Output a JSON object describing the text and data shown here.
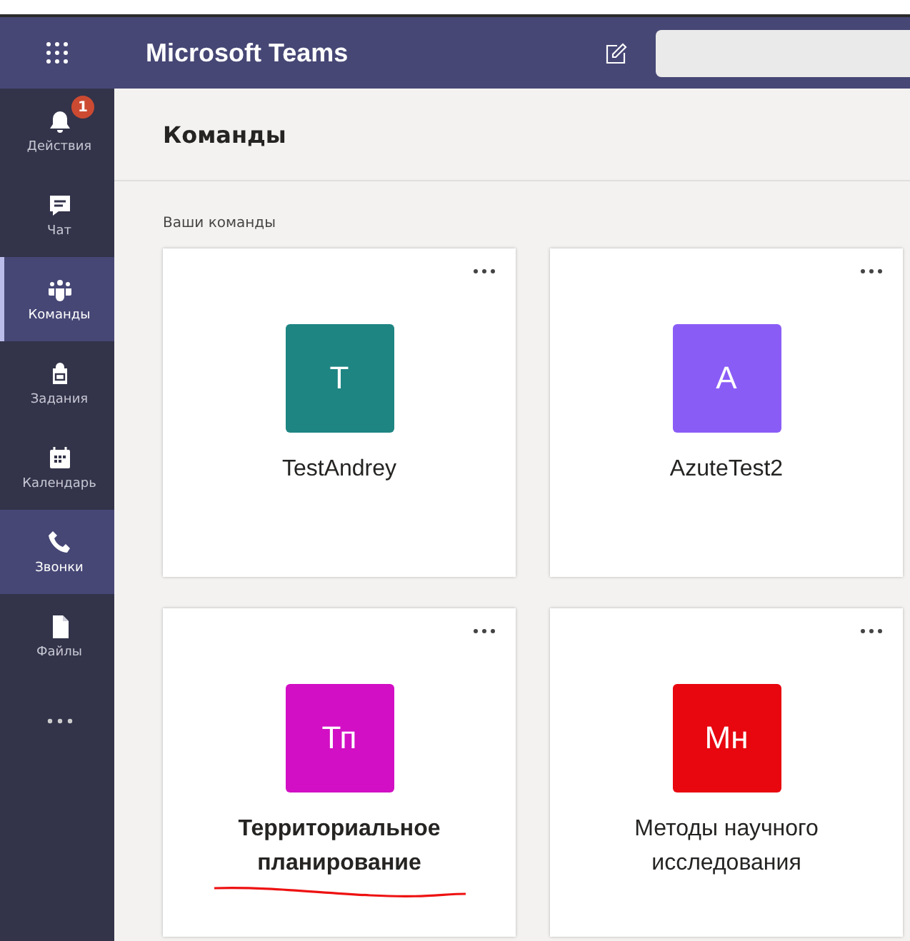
{
  "app": {
    "title": "Microsoft Teams"
  },
  "sidebar": {
    "items": [
      {
        "kind": "bell",
        "label": "Действия",
        "selected": false,
        "highlighted": false,
        "badge": "1"
      },
      {
        "kind": "chat",
        "label": "Чат",
        "selected": false,
        "highlighted": false
      },
      {
        "kind": "teams",
        "label": "Команды",
        "selected": true,
        "highlighted": false
      },
      {
        "kind": "bag",
        "label": "Задания",
        "selected": false,
        "highlighted": false
      },
      {
        "kind": "calendar",
        "label": "Календарь",
        "selected": false,
        "highlighted": false
      },
      {
        "kind": "phone",
        "label": "Звонки",
        "selected": false,
        "highlighted": true
      },
      {
        "kind": "file",
        "label": "Файлы",
        "selected": false,
        "highlighted": false
      },
      {
        "kind": "more",
        "selected": false,
        "highlighted": false
      }
    ]
  },
  "page": {
    "title": "Команды",
    "section": "Ваши команды"
  },
  "teams": [
    {
      "initials": "T",
      "name": "TestAndrey",
      "color": "#1e8582",
      "bold": false,
      "underlined": false
    },
    {
      "initials": "A",
      "name": "AzuteTest2",
      "color": "#8a5cf6",
      "bold": false,
      "underlined": false
    },
    {
      "initials": "Тп",
      "name": "Территориальное планирование",
      "color": "#d20fc4",
      "bold": true,
      "underlined": true
    },
    {
      "initials": "Мн",
      "name": "Методы научного исследования",
      "color": "#e8060f",
      "bold": false,
      "underlined": false
    }
  ]
}
